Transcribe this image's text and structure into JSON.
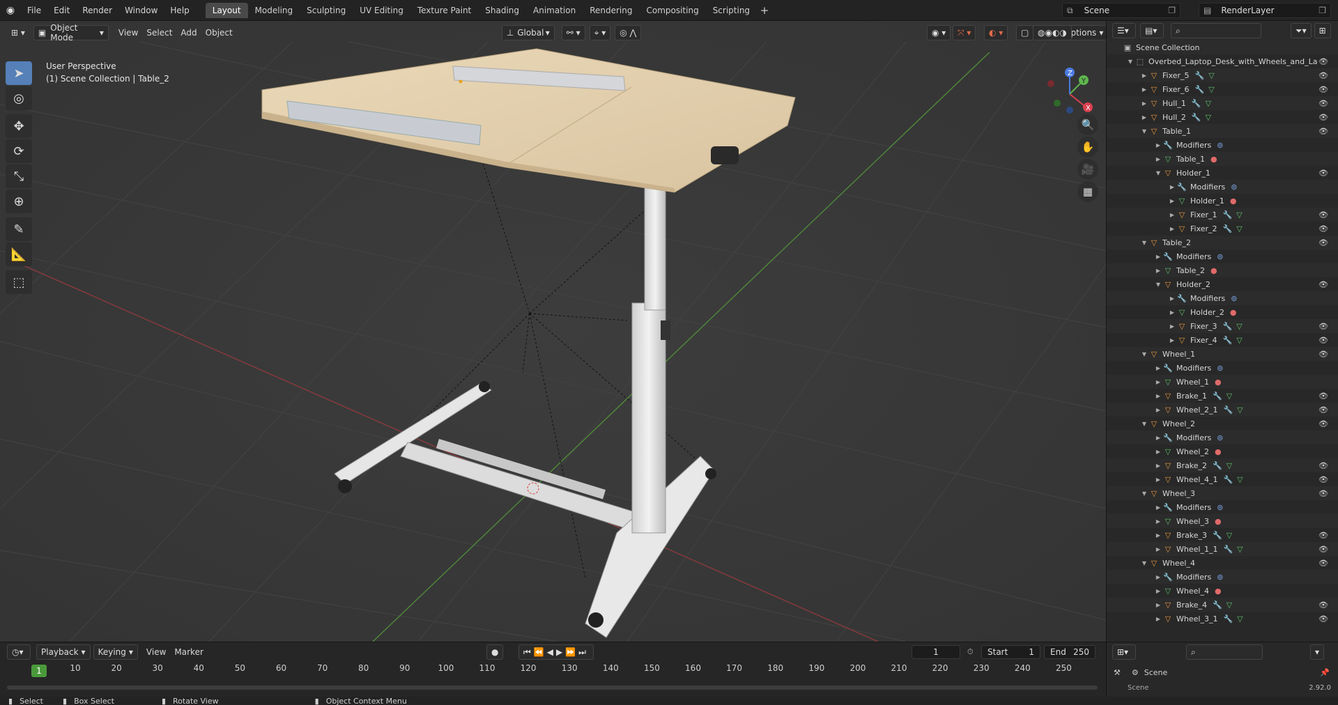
{
  "menubar": {
    "items": [
      "File",
      "Edit",
      "Render",
      "Window",
      "Help"
    ],
    "workspaces": [
      "Layout",
      "Modeling",
      "Sculpting",
      "UV Editing",
      "Texture Paint",
      "Shading",
      "Animation",
      "Rendering",
      "Compositing",
      "Scripting"
    ],
    "active_workspace": "Layout",
    "scene": "Scene",
    "render_layer": "RenderLayer"
  },
  "viewport": {
    "mode": "Object Mode",
    "menus": [
      "View",
      "Select",
      "Add",
      "Object"
    ],
    "transform_orientation": "Global",
    "options_label": "Options",
    "view_name": "User Perspective",
    "context": "(1) Scene Collection | Table_2",
    "axes": {
      "x": "X",
      "y": "Y",
      "z": "Z"
    }
  },
  "outliner": {
    "root": "Scene Collection",
    "rows": [
      {
        "depth": 1,
        "expanded": true,
        "icon": "col",
        "label": "Overbed_Laptop_Desk_with_Wheels_and_La",
        "extras": [],
        "eye": true
      },
      {
        "depth": 2,
        "expanded": false,
        "icon": "obj",
        "label": "Fixer_5",
        "extras": [
          "mod",
          "mesh"
        ],
        "eye": true
      },
      {
        "depth": 2,
        "expanded": false,
        "icon": "obj",
        "label": "Fixer_6",
        "extras": [
          "mod",
          "mesh"
        ],
        "eye": true
      },
      {
        "depth": 2,
        "expanded": false,
        "icon": "obj",
        "label": "Hull_1",
        "extras": [
          "mod",
          "mesh"
        ],
        "eye": true
      },
      {
        "depth": 2,
        "expanded": false,
        "icon": "obj",
        "label": "Hull_2",
        "extras": [
          "mod",
          "mesh"
        ],
        "eye": true
      },
      {
        "depth": 2,
        "expanded": true,
        "icon": "obj",
        "label": "Table_1",
        "extras": [],
        "eye": true
      },
      {
        "depth": 3,
        "expanded": false,
        "icon": "mod",
        "label": "Modifiers",
        "extras": [
          "modstack"
        ],
        "eye": false
      },
      {
        "depth": 3,
        "expanded": false,
        "icon": "mesh",
        "label": "Table_1",
        "extras": [
          "mat"
        ],
        "eye": false
      },
      {
        "depth": 3,
        "expanded": true,
        "icon": "obj",
        "label": "Holder_1",
        "extras": [],
        "eye": true
      },
      {
        "depth": 4,
        "expanded": false,
        "icon": "mod",
        "label": "Modifiers",
        "extras": [
          "modstack"
        ],
        "eye": false
      },
      {
        "depth": 4,
        "expanded": false,
        "icon": "mesh",
        "label": "Holder_1",
        "extras": [
          "mat"
        ],
        "eye": false
      },
      {
        "depth": 4,
        "expanded": false,
        "icon": "obj",
        "label": "Fixer_1",
        "extras": [
          "mod",
          "mesh"
        ],
        "eye": true
      },
      {
        "depth": 4,
        "expanded": false,
        "icon": "obj",
        "label": "Fixer_2",
        "extras": [
          "mod",
          "mesh"
        ],
        "eye": true
      },
      {
        "depth": 2,
        "expanded": true,
        "icon": "obj",
        "label": "Table_2",
        "extras": [],
        "eye": true
      },
      {
        "depth": 3,
        "expanded": false,
        "icon": "mod",
        "label": "Modifiers",
        "extras": [
          "modstack"
        ],
        "eye": false
      },
      {
        "depth": 3,
        "expanded": false,
        "icon": "mesh",
        "label": "Table_2",
        "extras": [
          "mat"
        ],
        "eye": false
      },
      {
        "depth": 3,
        "expanded": true,
        "icon": "obj",
        "label": "Holder_2",
        "extras": [],
        "eye": true
      },
      {
        "depth": 4,
        "expanded": false,
        "icon": "mod",
        "label": "Modifiers",
        "extras": [
          "modstack"
        ],
        "eye": false
      },
      {
        "depth": 4,
        "expanded": false,
        "icon": "mesh",
        "label": "Holder_2",
        "extras": [
          "mat"
        ],
        "eye": false
      },
      {
        "depth": 4,
        "expanded": false,
        "icon": "obj",
        "label": "Fixer_3",
        "extras": [
          "mod",
          "mesh"
        ],
        "eye": true
      },
      {
        "depth": 4,
        "expanded": false,
        "icon": "obj",
        "label": "Fixer_4",
        "extras": [
          "mod",
          "mesh"
        ],
        "eye": true
      },
      {
        "depth": 2,
        "expanded": true,
        "icon": "obj",
        "label": "Wheel_1",
        "extras": [],
        "eye": true
      },
      {
        "depth": 3,
        "expanded": false,
        "icon": "mod",
        "label": "Modifiers",
        "extras": [
          "modstack"
        ],
        "eye": false
      },
      {
        "depth": 3,
        "expanded": false,
        "icon": "mesh",
        "label": "Wheel_1",
        "extras": [
          "mat"
        ],
        "eye": false
      },
      {
        "depth": 3,
        "expanded": false,
        "icon": "obj",
        "label": "Brake_1",
        "extras": [
          "mod",
          "mesh"
        ],
        "eye": true
      },
      {
        "depth": 3,
        "expanded": false,
        "icon": "obj",
        "label": "Wheel_2_1",
        "extras": [
          "mod",
          "mesh"
        ],
        "eye": true
      },
      {
        "depth": 2,
        "expanded": true,
        "icon": "obj",
        "label": "Wheel_2",
        "extras": [],
        "eye": true
      },
      {
        "depth": 3,
        "expanded": false,
        "icon": "mod",
        "label": "Modifiers",
        "extras": [
          "modstack"
        ],
        "eye": false
      },
      {
        "depth": 3,
        "expanded": false,
        "icon": "mesh",
        "label": "Wheel_2",
        "extras": [
          "mat"
        ],
        "eye": false
      },
      {
        "depth": 3,
        "expanded": false,
        "icon": "obj",
        "label": "Brake_2",
        "extras": [
          "mod",
          "mesh"
        ],
        "eye": true
      },
      {
        "depth": 3,
        "expanded": false,
        "icon": "obj",
        "label": "Wheel_4_1",
        "extras": [
          "mod",
          "mesh"
        ],
        "eye": true
      },
      {
        "depth": 2,
        "expanded": true,
        "icon": "obj",
        "label": "Wheel_3",
        "extras": [],
        "eye": true
      },
      {
        "depth": 3,
        "expanded": false,
        "icon": "mod",
        "label": "Modifiers",
        "extras": [
          "modstack"
        ],
        "eye": false
      },
      {
        "depth": 3,
        "expanded": false,
        "icon": "mesh",
        "label": "Wheel_3",
        "extras": [
          "mat"
        ],
        "eye": false
      },
      {
        "depth": 3,
        "expanded": false,
        "icon": "obj",
        "label": "Brake_3",
        "extras": [
          "mod",
          "mesh"
        ],
        "eye": true
      },
      {
        "depth": 3,
        "expanded": false,
        "icon": "obj",
        "label": "Wheel_1_1",
        "extras": [
          "mod",
          "mesh"
        ],
        "eye": true
      },
      {
        "depth": 2,
        "expanded": true,
        "icon": "obj",
        "label": "Wheel_4",
        "extras": [],
        "eye": true
      },
      {
        "depth": 3,
        "expanded": false,
        "icon": "mod",
        "label": "Modifiers",
        "extras": [
          "modstack"
        ],
        "eye": false
      },
      {
        "depth": 3,
        "expanded": false,
        "icon": "mesh",
        "label": "Wheel_4",
        "extras": [
          "mat"
        ],
        "eye": false
      },
      {
        "depth": 3,
        "expanded": false,
        "icon": "obj",
        "label": "Brake_4",
        "extras": [
          "mod",
          "mesh"
        ],
        "eye": true
      },
      {
        "depth": 3,
        "expanded": false,
        "icon": "obj",
        "label": "Wheel_3_1",
        "extras": [
          "mod",
          "mesh"
        ],
        "eye": true
      }
    ]
  },
  "properties": {
    "scene_label": "Scene",
    "sub_label": "Scene",
    "version": "2.92.0"
  },
  "timeline": {
    "menus": [
      "Playback",
      "Keying",
      "View",
      "Marker"
    ],
    "current_frame": "1",
    "start_label": "Start",
    "start": "1",
    "end_label": "End",
    "end": "250",
    "ticks": [
      "10",
      "20",
      "30",
      "40",
      "50",
      "60",
      "70",
      "80",
      "90",
      "100",
      "110",
      "120",
      "130",
      "140",
      "150",
      "160",
      "170",
      "180",
      "190",
      "200",
      "210",
      "220",
      "230",
      "240",
      "250"
    ],
    "cursor": "1"
  },
  "statusbar": {
    "select": "Select",
    "box_select": "Box Select",
    "rotate_view": "Rotate View",
    "context_menu": "Object Context Menu"
  },
  "colors": {
    "accent": "#5580b8",
    "x_axis": "#d9404f",
    "y_axis": "#5fb64f",
    "z_axis": "#4a7be0",
    "frame_cursor": "#4a9a3b"
  }
}
